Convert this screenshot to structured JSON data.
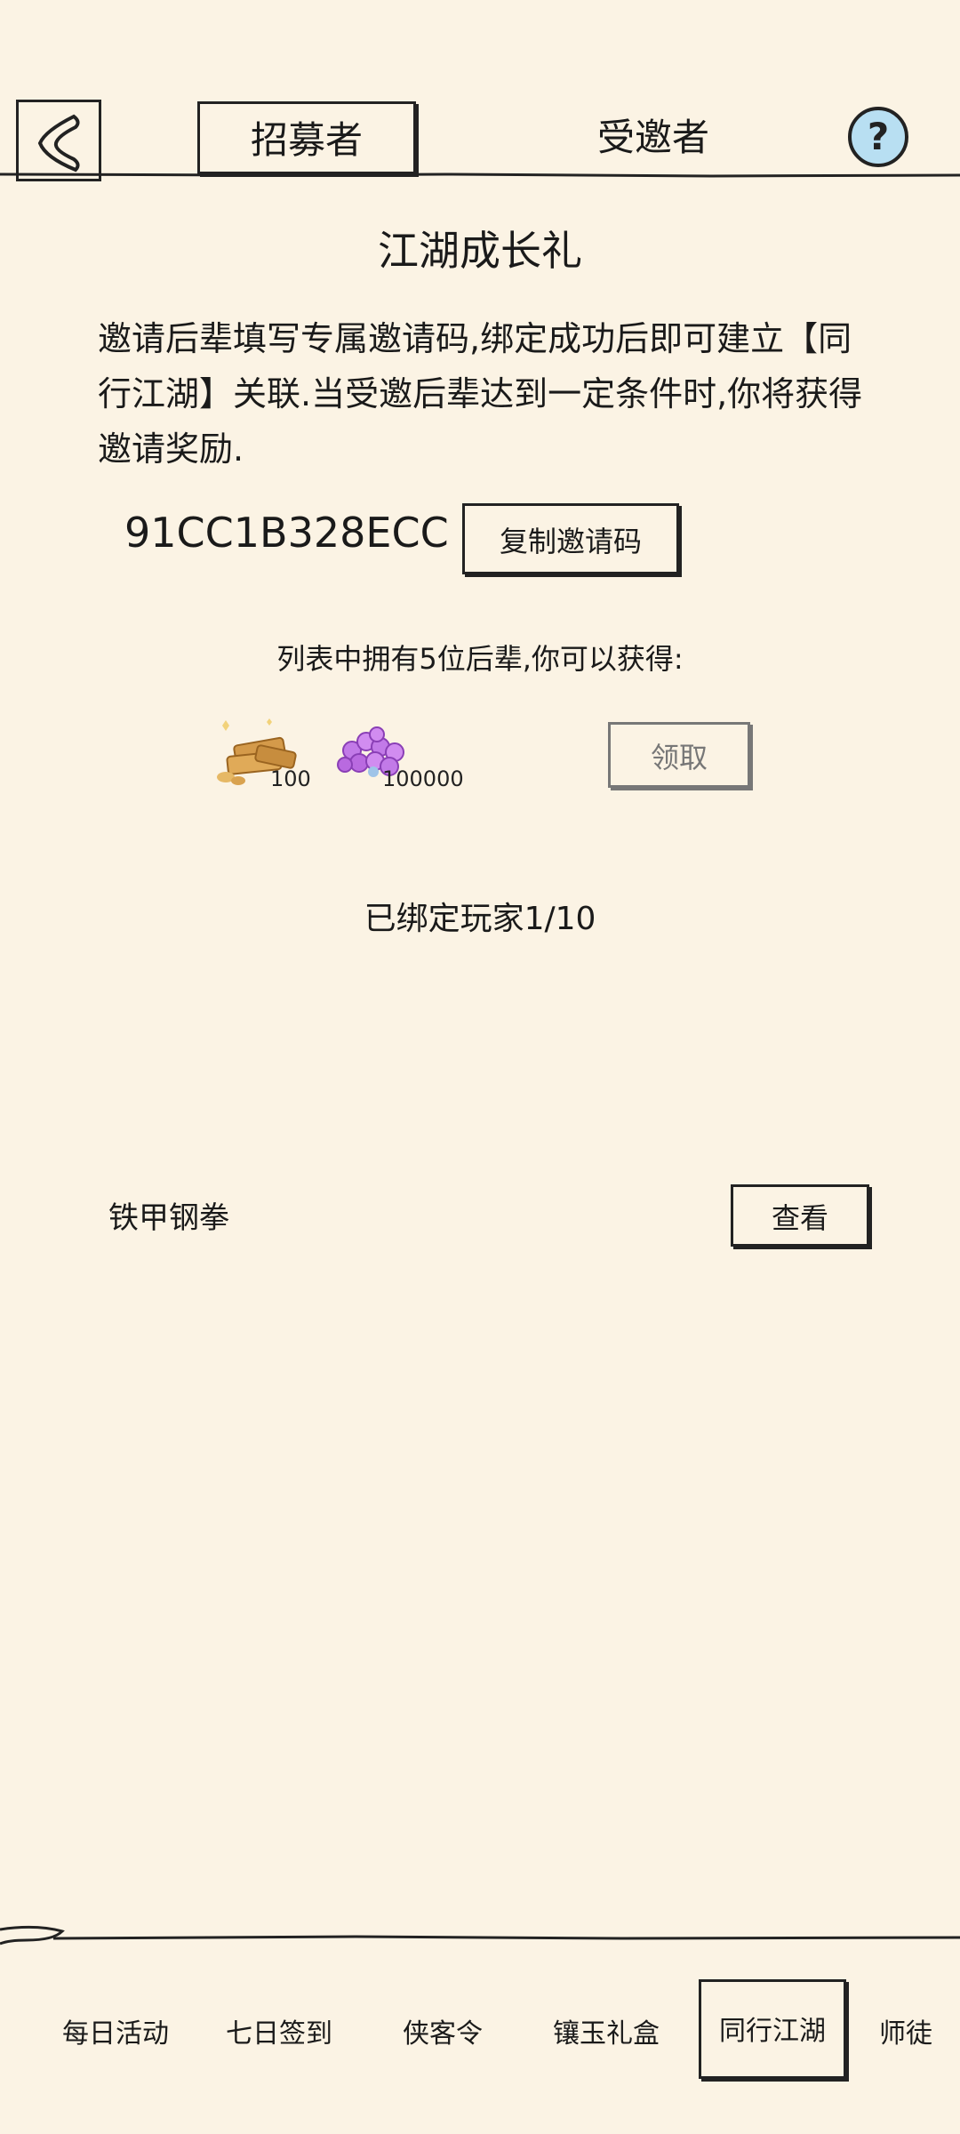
{
  "header": {
    "back_icon": "back-chevron-icon",
    "tabs": [
      {
        "label": "招募者",
        "active": true
      },
      {
        "label": "受邀者",
        "active": false
      }
    ],
    "help_icon": "question-icon",
    "help_color": "#b8dff2"
  },
  "main": {
    "title": "江湖成长礼",
    "description": "邀请后辈填写专属邀请码,绑定成功后即可建立【同行江湖】关联.当受邀后辈达到一定条件时,你将获得邀请奖励.",
    "invite_code": "91CC1B328ECC",
    "copy_button": "复制邀请码",
    "reward_desc": "列表中拥有5位后辈,你可以获得:",
    "rewards": [
      {
        "icon": "gold-ingot-icon",
        "count": "100"
      },
      {
        "icon": "purple-gem-icon",
        "count": "100000"
      }
    ],
    "claim_button": "领取",
    "bound_text": "已绑定玩家1/10",
    "players": [
      {
        "name": "铁甲钢拳",
        "view_button": "查看"
      }
    ]
  },
  "bottom_nav": {
    "items": [
      {
        "label": "每日活动"
      },
      {
        "label": "七日签到"
      },
      {
        "label": "侠客令"
      },
      {
        "label": "镶玉礼盒"
      },
      {
        "label": "同行江湖",
        "active": true
      },
      {
        "label": "师徒"
      }
    ]
  }
}
